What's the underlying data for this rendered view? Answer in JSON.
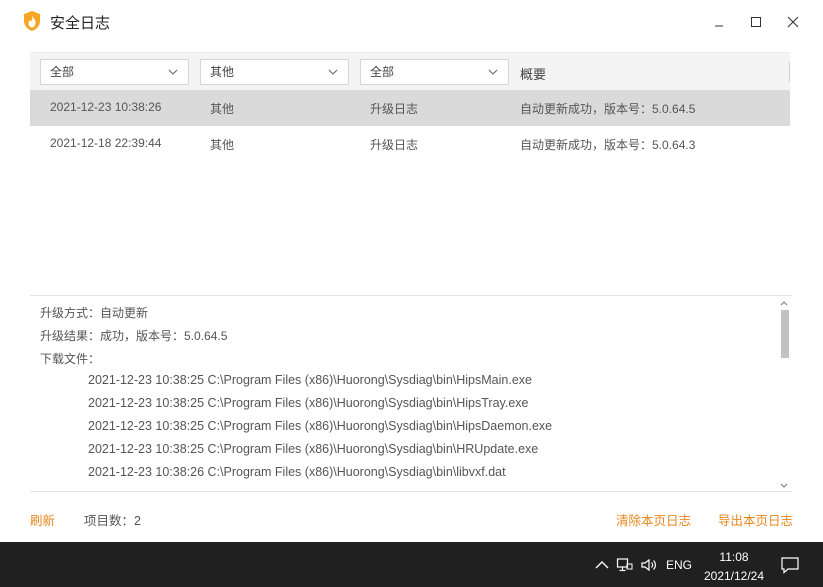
{
  "window": {
    "title": "安全日志",
    "brand_color": "#f5a623",
    "accent_color": "#e8861c"
  },
  "filters": {
    "type": "全部",
    "category": "其他",
    "log_type": "全部",
    "summary_header": "概要"
  },
  "rows": [
    {
      "time": "2021-12-23 10:38:26",
      "category": "其他",
      "type": "升级日志",
      "summary": "自动更新成功，版本号：5.0.64.5",
      "selected": true
    },
    {
      "time": "2021-12-18 22:39:44",
      "category": "其他",
      "type": "升级日志",
      "summary": "自动更新成功，版本号：5.0.64.3",
      "selected": false
    }
  ],
  "detail": {
    "method": "升级方式：自动更新",
    "result": "升级结果：成功，版本号：5.0.64.5",
    "files_label": "下载文件：",
    "files": [
      "2021-12-23 10:38:25 C:\\Program Files (x86)\\Huorong\\Sysdiag\\bin\\HipsMain.exe",
      "2021-12-23 10:38:25 C:\\Program Files (x86)\\Huorong\\Sysdiag\\bin\\HipsTray.exe",
      "2021-12-23 10:38:25 C:\\Program Files (x86)\\Huorong\\Sysdiag\\bin\\HipsDaemon.exe",
      "2021-12-23 10:38:25 C:\\Program Files (x86)\\Huorong\\Sysdiag\\bin\\HRUpdate.exe",
      "2021-12-23 10:38:26 C:\\Program Files (x86)\\Huorong\\Sysdiag\\bin\\libvxf.dat"
    ]
  },
  "footer": {
    "refresh": "刷新",
    "count": "项目数：2",
    "clear": "清除本页日志",
    "export": "导出本页日志"
  },
  "taskbar": {
    "lang": "ENG",
    "time": "11:08",
    "date": "2021/12/24"
  }
}
